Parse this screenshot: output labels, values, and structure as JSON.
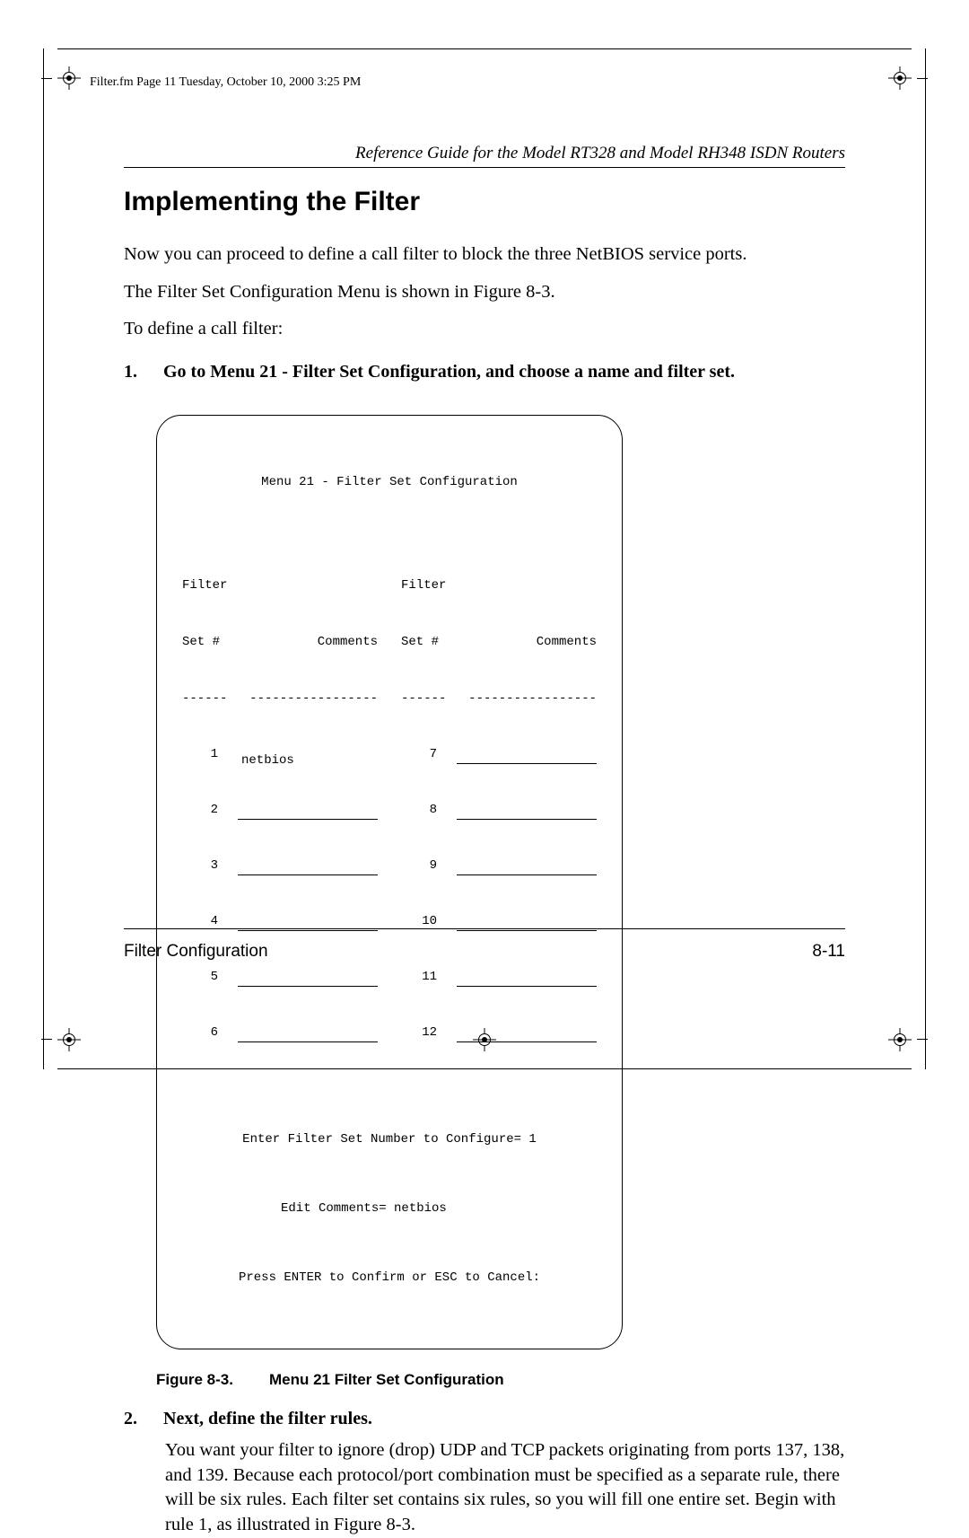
{
  "framemaker_header": "Filter.fm  Page 11  Tuesday, October 10, 2000  3:25 PM",
  "running_head": "Reference Guide for the Model RT328 and Model RH348 ISDN Routers",
  "heading": "Implementing the Filter",
  "para1": "Now you can proceed to define a call filter to block the three NetBIOS service ports.",
  "para2": "The Filter Set Configuration Menu is shown in Figure 8-3.",
  "para3": "To define a call filter:",
  "step1_num": "1.",
  "step1_text": "Go to Menu 21 - Filter Set Configuration, and choose a name and filter set.",
  "terminal": {
    "title": "Menu 21 - Filter Set Configuration",
    "col_left": {
      "h1": "Filter",
      "h2a": "Set #",
      "h2b": "Comments",
      "dash_a": "------",
      "dash_b": "-----------------",
      "rows": [
        {
          "idx": "1",
          "val": "netbios"
        },
        {
          "idx": "2",
          "val": ""
        },
        {
          "idx": "3",
          "val": ""
        },
        {
          "idx": "4",
          "val": ""
        },
        {
          "idx": "5",
          "val": ""
        },
        {
          "idx": "6",
          "val": ""
        }
      ]
    },
    "col_right": {
      "h1": "Filter",
      "h2a": "Set #",
      "h2b": "Comments",
      "dash_a": "------",
      "dash_b": "-----------------",
      "rows": [
        {
          "idx": "7",
          "val": ""
        },
        {
          "idx": "8",
          "val": ""
        },
        {
          "idx": "9",
          "val": ""
        },
        {
          "idx": "10",
          "val": ""
        },
        {
          "idx": "11",
          "val": ""
        },
        {
          "idx": "12",
          "val": ""
        }
      ]
    },
    "prompt1": "Enter Filter Set Number to Configure= 1",
    "prompt2": "Edit Comments= netbios",
    "prompt3": "Press ENTER to Confirm or ESC to Cancel:"
  },
  "figcap_label": "Figure 8-3.",
  "figcap_text": "Menu 21 Filter Set Configuration",
  "step2_num": "2.",
  "step2_text": "Next, define the filter rules.",
  "step2_body": "You want your filter to ignore (drop) UDP and TCP packets originating from ports 137, 138, and 139. Because each protocol/port combination must be specified as a separate rule, there will be six rules. Each filter set contains six rules, so you will fill one entire set. Begin with rule 1, as illustrated in Figure 8-3.",
  "footer_left": "Filter Configuration",
  "footer_right": "8-11"
}
